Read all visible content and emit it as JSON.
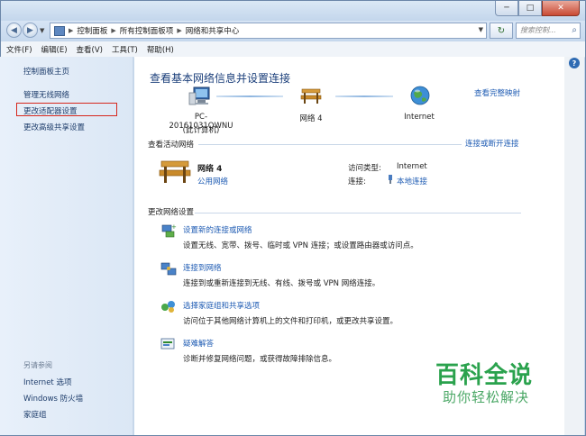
{
  "window": {
    "buttons": {
      "minimize": "─",
      "maximize": "□",
      "close": "✕"
    }
  },
  "nav": {
    "back": "◀",
    "forward": "▶",
    "breadcrumbs": [
      "控制面板",
      "所有控制面板项",
      "网络和共享中心"
    ],
    "refresh": "↻",
    "search_placeholder": "搜索控制...",
    "search_icon": "magnifier-icon"
  },
  "menu": [
    "文件(F)",
    "编辑(E)",
    "查看(V)",
    "工具(T)",
    "帮助(H)"
  ],
  "sidebar": {
    "items": [
      "控制面板主页",
      "管理无线网络",
      "更改适配器设置",
      "更改高级共享设置"
    ],
    "highlighted_index": 2,
    "see_also_title": "另请参阅",
    "see_also": [
      "Internet 选项",
      "Windows 防火墙",
      "家庭组"
    ]
  },
  "main": {
    "title": "查看基本网络信息并设置连接",
    "full_map_link": "查看完整映射",
    "map": {
      "computer_name": "PC-20161031QWNU",
      "computer_sub": "(此计算机)",
      "network": "网络  4",
      "internet": "Internet"
    },
    "active_networks_title": "查看活动网络",
    "connect_link": "连接或断开连接",
    "active": {
      "name": "网络  4",
      "type": "公用网络",
      "access_label": "访问类型:",
      "access_value": "Internet",
      "conn_label": "连接:",
      "conn_value": "本地连接"
    },
    "change_title": "更改网络设置",
    "tasks": [
      {
        "title": "设置新的连接或网络",
        "desc": "设置无线、宽带、拨号、临时或 VPN 连接；或设置路由器或访问点。"
      },
      {
        "title": "连接到网络",
        "desc": "连接到或重新连接到无线、有线、拨号或 VPN 网络连接。"
      },
      {
        "title": "选择家庭组和共享选项",
        "desc": "访问位于其他网络计算机上的文件和打印机，或更改共享设置。"
      },
      {
        "title": "疑难解答",
        "desc": "诊断并修复网络问题，或获得故障排除信息。"
      }
    ],
    "help": "?"
  },
  "watermark": {
    "main": "百科全说",
    "sub": "助你轻松解决"
  }
}
